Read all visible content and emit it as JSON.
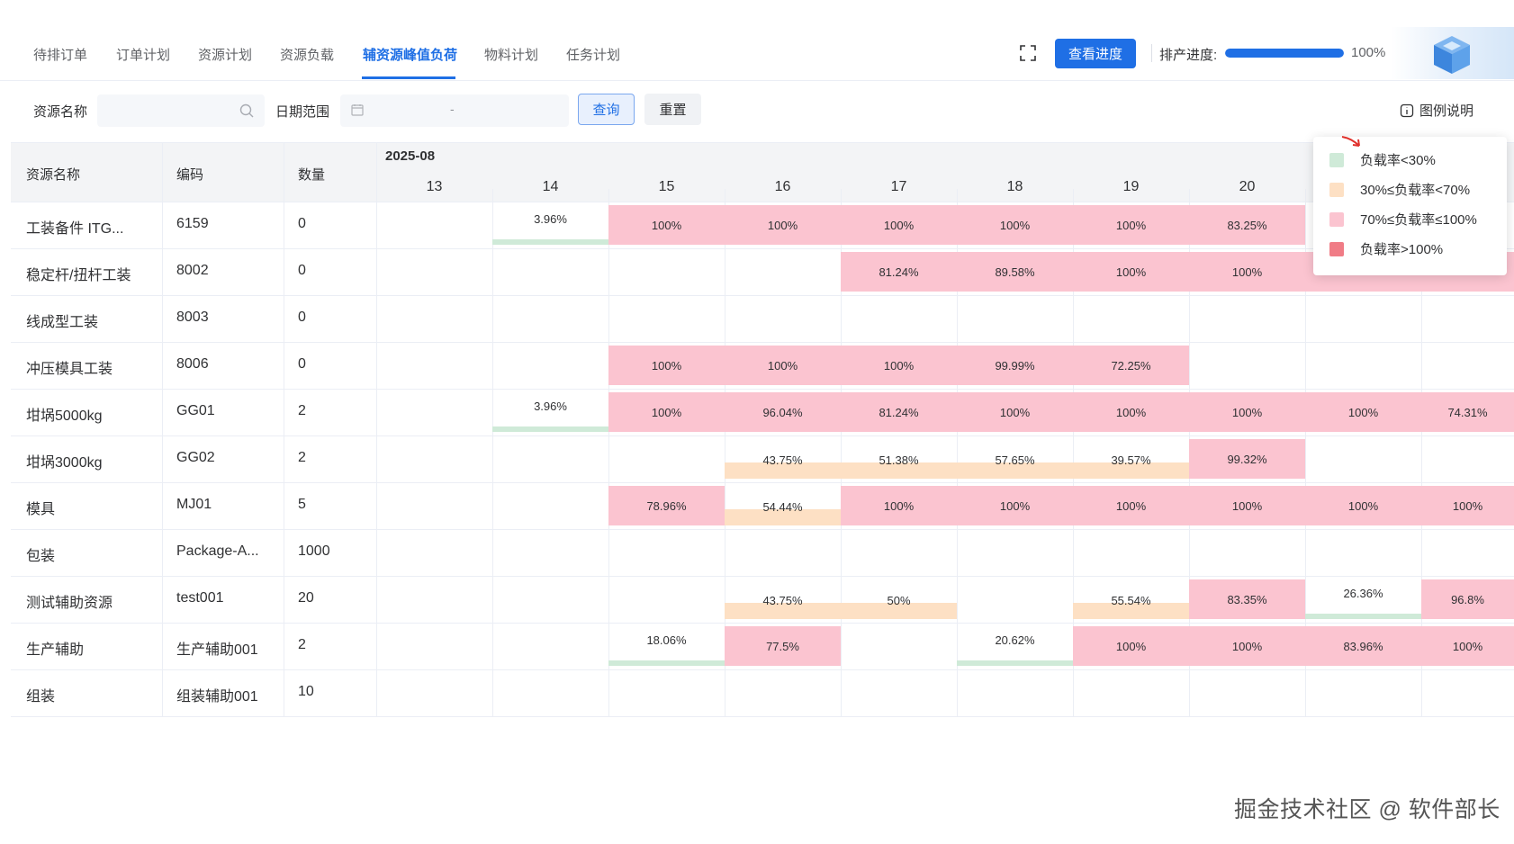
{
  "tabs": [
    "待排订单",
    "订单计划",
    "资源计划",
    "资源负载",
    "辅资源峰值负荷",
    "物料计划",
    "任务计划"
  ],
  "header": {
    "view_progress_label": "查看进度",
    "progress_label": "排产进度:",
    "progress_value": "100%",
    "progress_fraction": 1.0
  },
  "filters": {
    "resource_label": "资源名称",
    "resource_placeholder": "",
    "date_label": "日期范围",
    "date_separator": "-",
    "query_label": "查询",
    "reset_label": "重置",
    "legend_link": "图例说明"
  },
  "table": {
    "headers": {
      "name": "资源名称",
      "code": "编码",
      "qty": "数量"
    },
    "month": "2025-08",
    "days": [
      "13",
      "14",
      "15",
      "16",
      "17",
      "18",
      "19",
      "20"
    ],
    "rows": [
      {
        "name": "工装备件 ITG...",
        "code": "6159",
        "qty": "0",
        "cells": [
          {
            "d": 1,
            "v": "3.96%",
            "lvl": "low"
          },
          {
            "d": 2,
            "v": "100%",
            "lvl": "full"
          },
          {
            "d": 3,
            "v": "100%",
            "lvl": "full"
          },
          {
            "d": 4,
            "v": "100%",
            "lvl": "full"
          },
          {
            "d": 5,
            "v": "100%",
            "lvl": "full"
          },
          {
            "d": 6,
            "v": "100%",
            "lvl": "full"
          },
          {
            "d": 7,
            "v": "83.25%",
            "lvl": "full"
          }
        ]
      },
      {
        "name": "稳定杆/扭杆工装",
        "code": "8002",
        "qty": "0",
        "cells": [
          {
            "d": 4,
            "v": "81.24%",
            "lvl": "full"
          },
          {
            "d": 5,
            "v": "89.58%",
            "lvl": "full"
          },
          {
            "d": 6,
            "v": "100%",
            "lvl": "full"
          },
          {
            "d": 7,
            "v": "100%",
            "lvl": "full"
          },
          {
            "d": 8,
            "v": "",
            "lvl": "full"
          },
          {
            "d": 9,
            "v": "",
            "lvl": "full"
          }
        ]
      },
      {
        "name": "线成型工装",
        "code": "8003",
        "qty": "0",
        "cells": []
      },
      {
        "name": "冲压模具工装",
        "code": "8006",
        "qty": "0",
        "cells": [
          {
            "d": 2,
            "v": "100%",
            "lvl": "full"
          },
          {
            "d": 3,
            "v": "100%",
            "lvl": "full"
          },
          {
            "d": 4,
            "v": "100%",
            "lvl": "full"
          },
          {
            "d": 5,
            "v": "99.99%",
            "lvl": "full"
          },
          {
            "d": 6,
            "v": "72.25%",
            "lvl": "full"
          }
        ]
      },
      {
        "name": "坩埚5000kg",
        "code": "GG01",
        "qty": "2",
        "cells": [
          {
            "d": 1,
            "v": "3.96%",
            "lvl": "low"
          },
          {
            "d": 2,
            "v": "100%",
            "lvl": "full"
          },
          {
            "d": 3,
            "v": "96.04%",
            "lvl": "full"
          },
          {
            "d": 4,
            "v": "81.24%",
            "lvl": "full"
          },
          {
            "d": 5,
            "v": "100%",
            "lvl": "full"
          },
          {
            "d": 6,
            "v": "100%",
            "lvl": "full"
          },
          {
            "d": 7,
            "v": "100%",
            "lvl": "full"
          },
          {
            "d": 8,
            "v": "100%",
            "lvl": "full"
          },
          {
            "d": 9,
            "v": "74.31%",
            "lvl": "full"
          }
        ]
      },
      {
        "name": "坩埚3000kg",
        "code": "GG02",
        "qty": "2",
        "cells": [
          {
            "d": 3,
            "v": "43.75%",
            "lvl": "mid"
          },
          {
            "d": 4,
            "v": "51.38%",
            "lvl": "mid"
          },
          {
            "d": 5,
            "v": "57.65%",
            "lvl": "mid"
          },
          {
            "d": 6,
            "v": "39.57%",
            "lvl": "mid"
          },
          {
            "d": 7,
            "v": "99.32%",
            "lvl": "full"
          }
        ]
      },
      {
        "name": "模具",
        "code": "MJ01",
        "qty": "5",
        "cells": [
          {
            "d": 2,
            "v": "78.96%",
            "lvl": "full"
          },
          {
            "d": 3,
            "v": "54.44%",
            "lvl": "mid"
          },
          {
            "d": 4,
            "v": "100%",
            "lvl": "full"
          },
          {
            "d": 5,
            "v": "100%",
            "lvl": "full"
          },
          {
            "d": 6,
            "v": "100%",
            "lvl": "full"
          },
          {
            "d": 7,
            "v": "100%",
            "lvl": "full"
          },
          {
            "d": 8,
            "v": "100%",
            "lvl": "full"
          },
          {
            "d": 9,
            "v": "100%",
            "lvl": "full"
          }
        ]
      },
      {
        "name": "包装",
        "code": "Package-A...",
        "qty": "1000",
        "cells": []
      },
      {
        "name": "测试辅助资源",
        "code": "test001",
        "qty": "20",
        "cells": [
          {
            "d": 3,
            "v": "43.75%",
            "lvl": "mid"
          },
          {
            "d": 4,
            "v": "50%",
            "lvl": "mid"
          },
          {
            "d": 6,
            "v": "55.54%",
            "lvl": "mid"
          },
          {
            "d": 7,
            "v": "83.35%",
            "lvl": "full"
          },
          {
            "d": 8,
            "v": "26.36%",
            "lvl": "low"
          },
          {
            "d": 9,
            "v": "96.8%",
            "lvl": "full"
          }
        ]
      },
      {
        "name": "生产辅助",
        "code": "生产辅助001",
        "qty": "2",
        "cells": [
          {
            "d": 2,
            "v": "18.06%",
            "lvl": "low"
          },
          {
            "d": 3,
            "v": "77.5%",
            "lvl": "full"
          },
          {
            "d": 5,
            "v": "20.62%",
            "lvl": "low"
          },
          {
            "d": 6,
            "v": "100%",
            "lvl": "full"
          },
          {
            "d": 7,
            "v": "100%",
            "lvl": "full"
          },
          {
            "d": 8,
            "v": "83.96%",
            "lvl": "full"
          },
          {
            "d": 9,
            "v": "100%",
            "lvl": "full"
          }
        ]
      },
      {
        "name": "组装",
        "code": "组装辅助001",
        "qty": "10",
        "cells": []
      }
    ]
  },
  "legend": {
    "items": [
      {
        "label": "负载率<30%",
        "color": "#cfead8"
      },
      {
        "label": "30%≤负载率<70%",
        "color": "#fde0c4"
      },
      {
        "label": "70%≤负载率≤100%",
        "color": "#fbc4d0"
      },
      {
        "label": "负载率>100%",
        "color": "#f07c86"
      }
    ]
  },
  "footer": "掘金技术社区 @ 软件部长",
  "colors": {
    "primary": "#1f6fe5",
    "full": "#fbc4d0",
    "mid": "#fde0c4",
    "low": "#cfead8",
    "over": "#f07c86"
  }
}
